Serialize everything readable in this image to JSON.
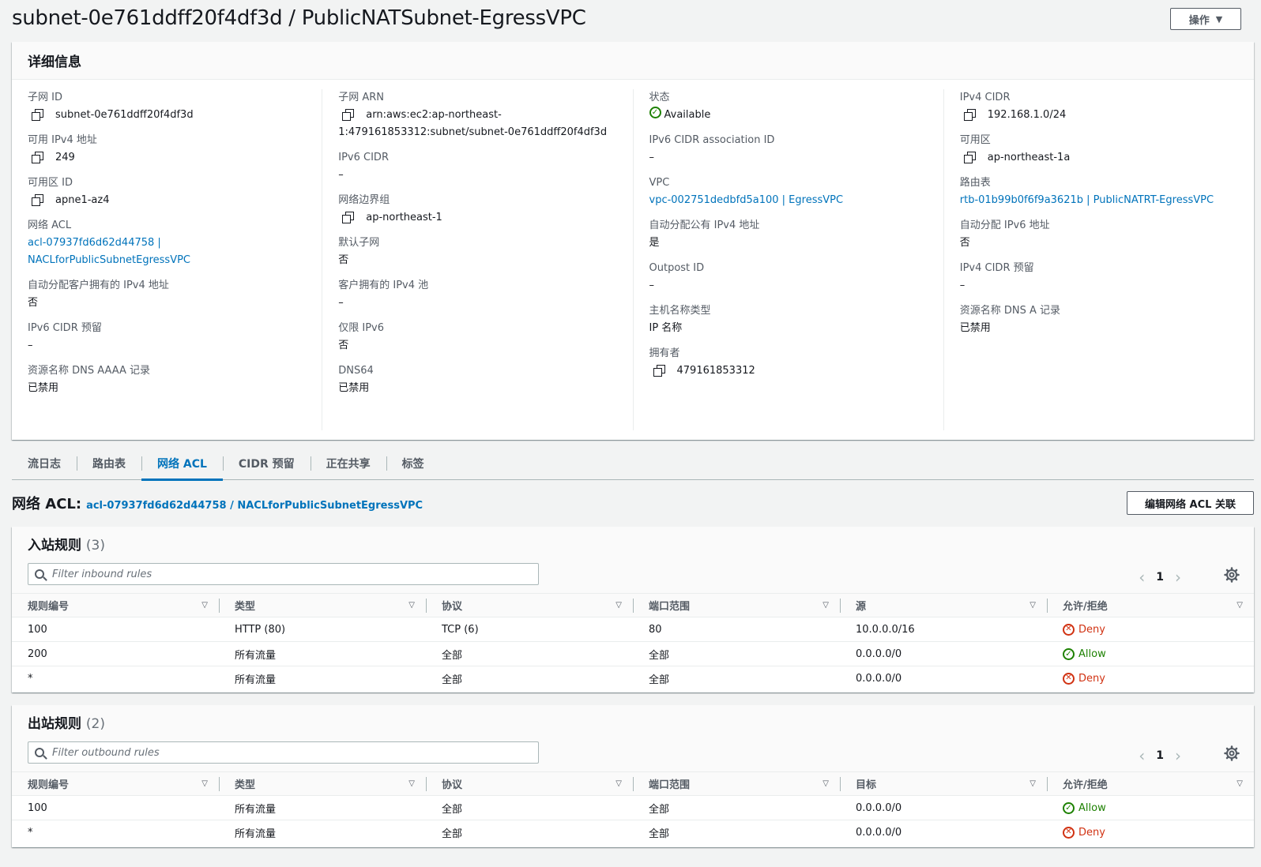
{
  "header": {
    "title": "subnet-0e761ddff20f4df3d / PublicNATSubnet-EgressVPC",
    "actions_label": "操作"
  },
  "details": {
    "title": "详细信息",
    "col1": [
      {
        "label": "子网 ID",
        "value": "subnet-0e761ddff20f4df3d"
      },
      {
        "label": "可用 IPv4 地址",
        "value": "249"
      },
      {
        "label": "可用区 ID",
        "value": "apne1-az4"
      },
      {
        "label": "网络 ACL",
        "value_line1": "acl-07937fd6d62d44758 |",
        "value_line2": "NACLforPublicSubnetEgressVPC"
      },
      {
        "label": "自动分配客户拥有的 IPv4 地址",
        "value": "否"
      },
      {
        "label": "IPv6 CIDR 预留",
        "value": "–"
      },
      {
        "label": "资源名称 DNS AAAA 记录",
        "value": "已禁用"
      }
    ],
    "col2": [
      {
        "label": "子网 ARN",
        "value_line1": "arn:aws:ec2:ap-northeast-",
        "value_line2": "1:479161853312:subnet/subnet-0e761ddff20f4df3d"
      },
      {
        "label": "IPv6 CIDR",
        "value": "–"
      },
      {
        "label": "网络边界组",
        "value": "ap-northeast-1"
      },
      {
        "label": "默认子网",
        "value": "否"
      },
      {
        "label": "客户拥有的 IPv4 池",
        "value": "–"
      },
      {
        "label": "仅限 IPv6",
        "value": "否"
      },
      {
        "label": "DNS64",
        "value": "已禁用"
      }
    ],
    "col3": [
      {
        "label": "状态",
        "value": "Available"
      },
      {
        "label": "IPv6 CIDR association ID",
        "value": "–"
      },
      {
        "label": "VPC",
        "value": "vpc-002751dedbfd5a100 | EgressVPC"
      },
      {
        "label": "自动分配公有 IPv4 地址",
        "value": "是"
      },
      {
        "label": "Outpost ID",
        "value": "–"
      },
      {
        "label": "主机名称类型",
        "value": "IP 名称"
      },
      {
        "label": "拥有者",
        "value": "479161853312"
      }
    ],
    "col4": [
      {
        "label": "IPv4 CIDR",
        "value": "192.168.1.0/24"
      },
      {
        "label": "可用区",
        "value": "ap-northeast-1a"
      },
      {
        "label": "路由表",
        "value": "rtb-01b99b0f6f9a3621b | PublicNATRT-EgressVPC"
      },
      {
        "label": "自动分配 IPv6 地址",
        "value": "否"
      },
      {
        "label": "IPv4 CIDR 预留",
        "value": "–"
      },
      {
        "label": "资源名称 DNS A 记录",
        "value": "已禁用"
      }
    ]
  },
  "tabs": [
    "流日志",
    "路由表",
    "网络 ACL",
    "CIDR 预留",
    "正在共享",
    "标签"
  ],
  "acl": {
    "label": "网络 ACL:",
    "link": "acl-07937fd6d62d44758 / NACLforPublicSubnetEgressVPC",
    "edit_label": "编辑网络 ACL 关联"
  },
  "inbound": {
    "title": "入站规则",
    "count": "(3)",
    "filter_placeholder": "Filter inbound rules",
    "page": "1",
    "columns": [
      "规则编号",
      "类型",
      "协议",
      "端口范围",
      "源",
      "允许/拒绝"
    ],
    "rows": [
      {
        "num": "100",
        "type": "HTTP (80)",
        "protocol": "TCP (6)",
        "port": "80",
        "cidr": "10.0.0.0/16",
        "action": "Deny"
      },
      {
        "num": "200",
        "type": "所有流量",
        "protocol": "全部",
        "port": "全部",
        "cidr": "0.0.0.0/0",
        "action": "Allow"
      },
      {
        "num": "*",
        "type": "所有流量",
        "protocol": "全部",
        "port": "全部",
        "cidr": "0.0.0.0/0",
        "action": "Deny"
      }
    ]
  },
  "outbound": {
    "title": "出站规则",
    "count": "(2)",
    "filter_placeholder": "Filter outbound rules",
    "page": "1",
    "columns": [
      "规则编号",
      "类型",
      "协议",
      "端口范围",
      "目标",
      "允许/拒绝"
    ],
    "rows": [
      {
        "num": "100",
        "type": "所有流量",
        "protocol": "全部",
        "port": "全部",
        "cidr": "0.0.0.0/0",
        "action": "Allow"
      },
      {
        "num": "*",
        "type": "所有流量",
        "protocol": "全部",
        "port": "全部",
        "cidr": "0.0.0.0/0",
        "action": "Deny"
      }
    ]
  },
  "colors": {
    "link": "#0073bb",
    "allow": "#1d8102",
    "deny": "#d13212"
  }
}
